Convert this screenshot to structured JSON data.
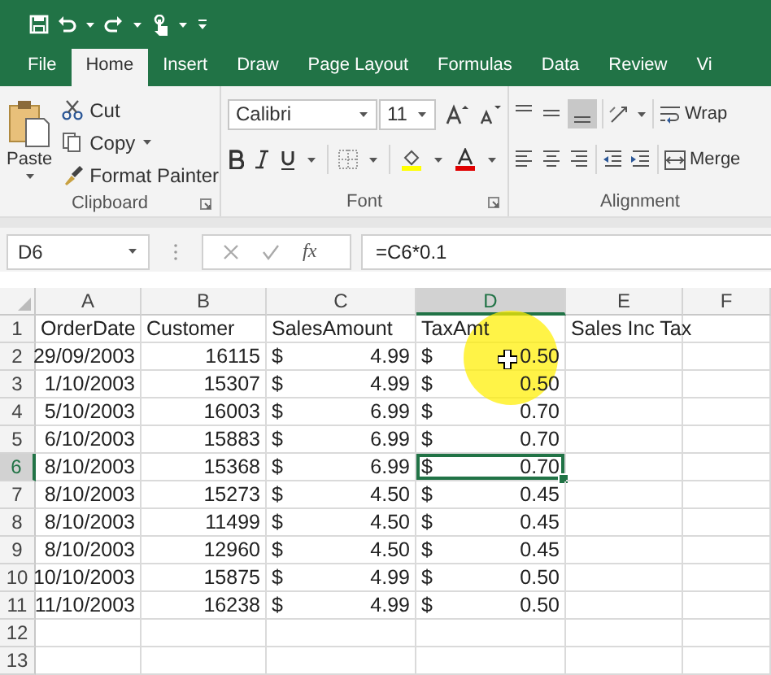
{
  "tabs": [
    {
      "label": "File",
      "selected": false
    },
    {
      "label": "Home",
      "selected": true
    },
    {
      "label": "Insert",
      "selected": false
    },
    {
      "label": "Draw",
      "selected": false
    },
    {
      "label": "Page Layout",
      "selected": false
    },
    {
      "label": "Formulas",
      "selected": false
    },
    {
      "label": "Data",
      "selected": false
    },
    {
      "label": "Review",
      "selected": false
    },
    {
      "label": "Vi",
      "selected": false
    }
  ],
  "ribbon": {
    "clipboard": {
      "paste": "Paste",
      "cut": "Cut",
      "copy": "Copy",
      "format_painter": "Format Painter",
      "label": "Clipboard"
    },
    "font": {
      "font_name": "Calibri",
      "font_size": "11",
      "label": "Font"
    },
    "alignment": {
      "wrap": "Wrap",
      "merge": "Merge",
      "label": "Alignment"
    }
  },
  "formula_bar": {
    "name_box": "D6",
    "function_label": "fx",
    "formula": "=C6*0.1"
  },
  "sheet": {
    "columns": [
      {
        "label": "A",
        "selected": false
      },
      {
        "label": "B",
        "selected": false
      },
      {
        "label": "C",
        "selected": false
      },
      {
        "label": "D",
        "selected": true
      },
      {
        "label": "E",
        "selected": false
      },
      {
        "label": "F",
        "selected": false
      }
    ],
    "rows": [
      {
        "label": "1",
        "selected": false,
        "cells": [
          {
            "kind": "text",
            "text": "OrderDate"
          },
          {
            "kind": "text",
            "text": "Customer"
          },
          {
            "kind": "text",
            "text": "SalesAmount"
          },
          {
            "kind": "text",
            "text": "TaxAmt"
          },
          {
            "kind": "text",
            "text": "Sales Inc Tax"
          }
        ]
      },
      {
        "label": "2",
        "selected": false,
        "cells": [
          {
            "kind": "number",
            "text": "29/09/2003"
          },
          {
            "kind": "number",
            "text": "16115"
          },
          {
            "kind": "currency",
            "symbol": "$",
            "text": "4.99"
          },
          {
            "kind": "currency",
            "symbol": "$",
            "text": "0.50"
          }
        ]
      },
      {
        "label": "3",
        "selected": false,
        "cells": [
          {
            "kind": "number",
            "text": "1/10/2003"
          },
          {
            "kind": "number",
            "text": "15307"
          },
          {
            "kind": "currency",
            "symbol": "$",
            "text": "4.99"
          },
          {
            "kind": "currency",
            "symbol": "$",
            "text": "0.50"
          }
        ]
      },
      {
        "label": "4",
        "selected": false,
        "cells": [
          {
            "kind": "number",
            "text": "5/10/2003"
          },
          {
            "kind": "number",
            "text": "16003"
          },
          {
            "kind": "currency",
            "symbol": "$",
            "text": "6.99"
          },
          {
            "kind": "currency",
            "symbol": "$",
            "text": "0.70"
          }
        ]
      },
      {
        "label": "5",
        "selected": false,
        "cells": [
          {
            "kind": "number",
            "text": "6/10/2003"
          },
          {
            "kind": "number",
            "text": "15883"
          },
          {
            "kind": "currency",
            "symbol": "$",
            "text": "6.99"
          },
          {
            "kind": "currency",
            "symbol": "$",
            "text": "0.70"
          }
        ]
      },
      {
        "label": "6",
        "selected": true,
        "cells": [
          {
            "kind": "number",
            "text": "8/10/2003"
          },
          {
            "kind": "number",
            "text": "15368"
          },
          {
            "kind": "currency",
            "symbol": "$",
            "text": "6.99"
          },
          {
            "kind": "currency",
            "symbol": "$",
            "text": "0.70",
            "selected": true
          }
        ]
      },
      {
        "label": "7",
        "selected": false,
        "cells": [
          {
            "kind": "number",
            "text": "8/10/2003"
          },
          {
            "kind": "number",
            "text": "15273"
          },
          {
            "kind": "currency",
            "symbol": "$",
            "text": "4.50"
          },
          {
            "kind": "currency",
            "symbol": "$",
            "text": "0.45"
          }
        ]
      },
      {
        "label": "8",
        "selected": false,
        "cells": [
          {
            "kind": "number",
            "text": "8/10/2003"
          },
          {
            "kind": "number",
            "text": "11499"
          },
          {
            "kind": "currency",
            "symbol": "$",
            "text": "4.50"
          },
          {
            "kind": "currency",
            "symbol": "$",
            "text": "0.45"
          }
        ]
      },
      {
        "label": "9",
        "selected": false,
        "cells": [
          {
            "kind": "number",
            "text": "8/10/2003"
          },
          {
            "kind": "number",
            "text": "12960"
          },
          {
            "kind": "currency",
            "symbol": "$",
            "text": "4.50"
          },
          {
            "kind": "currency",
            "symbol": "$",
            "text": "0.45"
          }
        ]
      },
      {
        "label": "10",
        "selected": false,
        "cells": [
          {
            "kind": "number",
            "text": "10/10/2003"
          },
          {
            "kind": "number",
            "text": "15875"
          },
          {
            "kind": "currency",
            "symbol": "$",
            "text": "4.99"
          },
          {
            "kind": "currency",
            "symbol": "$",
            "text": "0.50"
          }
        ]
      },
      {
        "label": "11",
        "selected": false,
        "cells": [
          {
            "kind": "number",
            "text": "11/10/2003"
          },
          {
            "kind": "number",
            "text": "16238"
          },
          {
            "kind": "currency",
            "symbol": "$",
            "text": "4.99"
          },
          {
            "kind": "currency",
            "symbol": "$",
            "text": "0.50"
          }
        ]
      },
      {
        "label": "12",
        "selected": false,
        "cells": []
      },
      {
        "label": "13",
        "selected": false,
        "cells": []
      }
    ]
  }
}
